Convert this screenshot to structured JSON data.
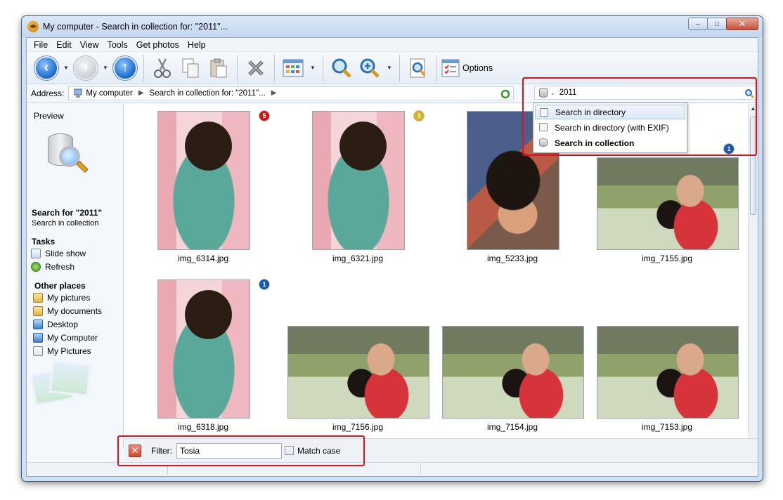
{
  "window": {
    "title": "My computer - Search in collection for: \"2011\"...",
    "controls": {
      "minimize": "–",
      "maximize": "□",
      "close": "✕"
    }
  },
  "menu": [
    "File",
    "Edit",
    "View",
    "Tools",
    "Get photos",
    "Help"
  ],
  "toolbar": {
    "options_label": "Options",
    "icons": [
      "back-icon",
      "forward-icon",
      "up-icon",
      "cut-icon",
      "copy-icon",
      "paste-icon",
      "delete-icon",
      "view-mode-icon",
      "search-icon",
      "search-advanced-icon",
      "preview-icon",
      "options-icon"
    ]
  },
  "address": {
    "label": "Address:",
    "crumbs": [
      "My computer",
      "Search in collection for: \"2011\"..."
    ]
  },
  "search": {
    "value": "2011",
    "menu": [
      {
        "label": "Search in directory",
        "selected": false
      },
      {
        "label": "Search in directory (with EXIF)",
        "selected": false
      },
      {
        "label": "Search in collection",
        "selected": true
      }
    ]
  },
  "left_panel": {
    "preview_label": "Preview",
    "search_title": "Search for \"2011\"",
    "search_subtitle": "Search in collection",
    "tasks_heading": "Tasks",
    "tasks": [
      "Slide show",
      "Refresh"
    ],
    "other_heading": "Other places",
    "places": [
      "My pictures",
      "My documents",
      "Desktop",
      "My Computer",
      "My Pictures"
    ]
  },
  "thumbnails": [
    {
      "name": "img_6314.jpg",
      "badge": "5",
      "badge_color": "#c8171b"
    },
    {
      "name": "img_6321.jpg",
      "badge": "3",
      "badge_color": "#d3b218"
    },
    {
      "name": "img_5233.jpg",
      "badge": "",
      "badge_color": ""
    },
    {
      "name": "img_7155.jpg",
      "badge": "1",
      "badge_color": "#1756b3"
    },
    {
      "name": "img_6318.jpg",
      "badge": "1",
      "badge_color": "#1756b3"
    },
    {
      "name": "img_7156.jpg",
      "badge": "",
      "badge_color": ""
    },
    {
      "name": "img_7154.jpg",
      "badge": "",
      "badge_color": ""
    },
    {
      "name": "img_7153.jpg",
      "badge": "",
      "badge_color": ""
    }
  ],
  "filter": {
    "label": "Filter:",
    "value": "Tosia",
    "match_case_label": "Match case",
    "match_case_checked": false
  },
  "colors": {
    "highlight": "#e0101e",
    "accent": "#1f6fd0"
  }
}
